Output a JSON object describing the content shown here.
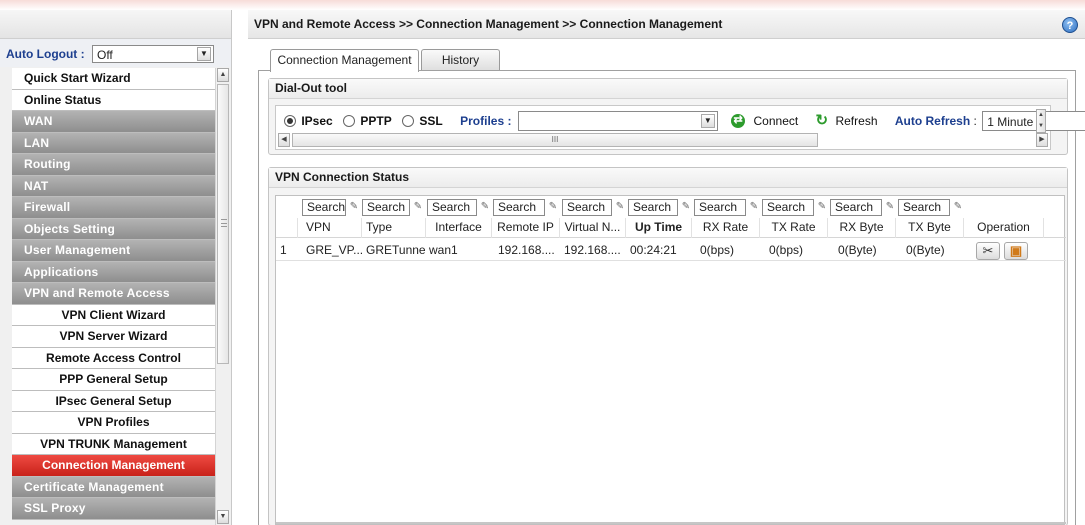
{
  "breadcrumb": "VPN and Remote Access >> Connection Management >> Connection Management",
  "help_icon": "?",
  "sidebar": {
    "auto_logout_label": "Auto Logout :",
    "auto_logout_value": "Off",
    "menu": [
      {
        "label": "Quick Start Wizard",
        "style": "white"
      },
      {
        "label": "Online Status",
        "style": "white"
      },
      {
        "label": "WAN",
        "style": "gray"
      },
      {
        "label": "LAN",
        "style": "gray"
      },
      {
        "label": "Routing",
        "style": "gray"
      },
      {
        "label": "NAT",
        "style": "gray"
      },
      {
        "label": "Firewall",
        "style": "gray"
      },
      {
        "label": "Objects Setting",
        "style": "gray"
      },
      {
        "label": "User Management",
        "style": "gray"
      },
      {
        "label": "Applications",
        "style": "gray"
      },
      {
        "label": "VPN and Remote Access",
        "style": "gray"
      },
      {
        "label": "VPN Client Wizard",
        "style": "sub"
      },
      {
        "label": "VPN Server Wizard",
        "style": "sub"
      },
      {
        "label": "Remote Access Control",
        "style": "sub"
      },
      {
        "label": "PPP General Setup",
        "style": "sub"
      },
      {
        "label": "IPsec General Setup",
        "style": "sub"
      },
      {
        "label": "VPN Profiles",
        "style": "sub"
      },
      {
        "label": "VPN TRUNK Management",
        "style": "sub"
      },
      {
        "label": "Connection Management",
        "style": "active"
      },
      {
        "label": "Certificate Management",
        "style": "gray"
      },
      {
        "label": "SSL Proxy",
        "style": "gray"
      }
    ]
  },
  "tabs": [
    {
      "label": "Connection Management",
      "active": true
    },
    {
      "label": "History",
      "active": false
    }
  ],
  "dial_out": {
    "title": "Dial-Out tool",
    "radios": [
      {
        "label": "IPsec",
        "selected": true
      },
      {
        "label": "PPTP",
        "selected": false
      },
      {
        "label": "SSL",
        "selected": false
      }
    ],
    "profiles_label": "Profiles :",
    "profiles_value": "",
    "connect_label": "Connect",
    "refresh_label": "Refresh",
    "auto_refresh_label": "Auto Refresh",
    "auto_refresh_sep": " :",
    "auto_refresh_value": "1 Minute",
    "scroll_thumb_mark": "III"
  },
  "status": {
    "title": "VPN Connection Status",
    "search_placeholder": "Search",
    "columns": [
      "VPN",
      "Type",
      "Interface",
      "Remote IP",
      "Virtual N...",
      "Up Time",
      "RX Rate",
      "TX Rate",
      "RX Byte",
      "TX Byte",
      "Operation"
    ],
    "rows": [
      {
        "index": "1",
        "vpn": "GRE_VP...",
        "type": "GRETunnel",
        "interface": "wan1",
        "remote_ip": "192.168....",
        "virtual_network": "192.168....",
        "up_time": "00:24:21",
        "rx_rate": "0(bps)",
        "tx_rate": "0(bps)",
        "rx_byte": "0(Byte)",
        "tx_byte": "0(Byte)"
      }
    ]
  },
  "colors": {
    "accent_blue": "#1d3f8f",
    "active_red": "#d42c24",
    "menu_gray": "#9e9e9e",
    "connect_green": "#2d9b2d"
  },
  "icons": [
    "help-icon",
    "dropdown-arrow-icon",
    "connect-icon",
    "refresh-icon",
    "search-clear-icon",
    "disconnect-icon",
    "detail-icon"
  ]
}
